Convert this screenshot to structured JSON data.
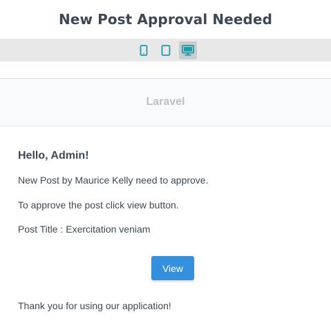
{
  "preview": {
    "title": "New Post Approval Needed",
    "devices": [
      {
        "name": "phone",
        "icon": "mobile-phone-icon",
        "active": false
      },
      {
        "name": "tablet",
        "icon": "tablet-icon",
        "active": false
      },
      {
        "name": "desktop",
        "icon": "desktop-monitor-icon",
        "active": true
      }
    ],
    "colors": {
      "device_icon": "#1b9aaa",
      "device_bar": "#e8e8e8"
    }
  },
  "email": {
    "brand": "Laravel",
    "greeting": "Hello, Admin!",
    "line1": "New Post by Maurice Kelly need to approve.",
    "line2": "To approve the post click view button.",
    "post_title_line": "Post Title : Exercitation veniam",
    "button_label": "View",
    "closing": "Thank you for using our application!",
    "colors": {
      "button": "#3490dc",
      "text": "#3d4852",
      "brand": "#bbbfc3"
    }
  }
}
